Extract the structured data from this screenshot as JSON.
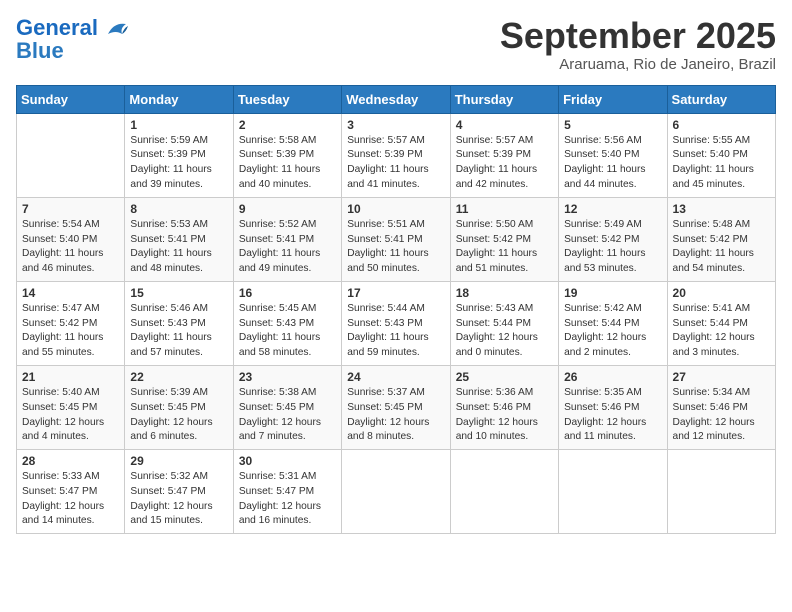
{
  "header": {
    "logo_line1": "General",
    "logo_line2": "Blue",
    "month": "September 2025",
    "location": "Araruama, Rio de Janeiro, Brazil"
  },
  "weekdays": [
    "Sunday",
    "Monday",
    "Tuesday",
    "Wednesday",
    "Thursday",
    "Friday",
    "Saturday"
  ],
  "weeks": [
    [
      {
        "day": "",
        "info": ""
      },
      {
        "day": "1",
        "info": "Sunrise: 5:59 AM\nSunset: 5:39 PM\nDaylight: 11 hours\nand 39 minutes."
      },
      {
        "day": "2",
        "info": "Sunrise: 5:58 AM\nSunset: 5:39 PM\nDaylight: 11 hours\nand 40 minutes."
      },
      {
        "day": "3",
        "info": "Sunrise: 5:57 AM\nSunset: 5:39 PM\nDaylight: 11 hours\nand 41 minutes."
      },
      {
        "day": "4",
        "info": "Sunrise: 5:57 AM\nSunset: 5:39 PM\nDaylight: 11 hours\nand 42 minutes."
      },
      {
        "day": "5",
        "info": "Sunrise: 5:56 AM\nSunset: 5:40 PM\nDaylight: 11 hours\nand 44 minutes."
      },
      {
        "day": "6",
        "info": "Sunrise: 5:55 AM\nSunset: 5:40 PM\nDaylight: 11 hours\nand 45 minutes."
      }
    ],
    [
      {
        "day": "7",
        "info": "Sunrise: 5:54 AM\nSunset: 5:40 PM\nDaylight: 11 hours\nand 46 minutes."
      },
      {
        "day": "8",
        "info": "Sunrise: 5:53 AM\nSunset: 5:41 PM\nDaylight: 11 hours\nand 48 minutes."
      },
      {
        "day": "9",
        "info": "Sunrise: 5:52 AM\nSunset: 5:41 PM\nDaylight: 11 hours\nand 49 minutes."
      },
      {
        "day": "10",
        "info": "Sunrise: 5:51 AM\nSunset: 5:41 PM\nDaylight: 11 hours\nand 50 minutes."
      },
      {
        "day": "11",
        "info": "Sunrise: 5:50 AM\nSunset: 5:42 PM\nDaylight: 11 hours\nand 51 minutes."
      },
      {
        "day": "12",
        "info": "Sunrise: 5:49 AM\nSunset: 5:42 PM\nDaylight: 11 hours\nand 53 minutes."
      },
      {
        "day": "13",
        "info": "Sunrise: 5:48 AM\nSunset: 5:42 PM\nDaylight: 11 hours\nand 54 minutes."
      }
    ],
    [
      {
        "day": "14",
        "info": "Sunrise: 5:47 AM\nSunset: 5:42 PM\nDaylight: 11 hours\nand 55 minutes."
      },
      {
        "day": "15",
        "info": "Sunrise: 5:46 AM\nSunset: 5:43 PM\nDaylight: 11 hours\nand 57 minutes."
      },
      {
        "day": "16",
        "info": "Sunrise: 5:45 AM\nSunset: 5:43 PM\nDaylight: 11 hours\nand 58 minutes."
      },
      {
        "day": "17",
        "info": "Sunrise: 5:44 AM\nSunset: 5:43 PM\nDaylight: 11 hours\nand 59 minutes."
      },
      {
        "day": "18",
        "info": "Sunrise: 5:43 AM\nSunset: 5:44 PM\nDaylight: 12 hours\nand 0 minutes."
      },
      {
        "day": "19",
        "info": "Sunrise: 5:42 AM\nSunset: 5:44 PM\nDaylight: 12 hours\nand 2 minutes."
      },
      {
        "day": "20",
        "info": "Sunrise: 5:41 AM\nSunset: 5:44 PM\nDaylight: 12 hours\nand 3 minutes."
      }
    ],
    [
      {
        "day": "21",
        "info": "Sunrise: 5:40 AM\nSunset: 5:45 PM\nDaylight: 12 hours\nand 4 minutes."
      },
      {
        "day": "22",
        "info": "Sunrise: 5:39 AM\nSunset: 5:45 PM\nDaylight: 12 hours\nand 6 minutes."
      },
      {
        "day": "23",
        "info": "Sunrise: 5:38 AM\nSunset: 5:45 PM\nDaylight: 12 hours\nand 7 minutes."
      },
      {
        "day": "24",
        "info": "Sunrise: 5:37 AM\nSunset: 5:45 PM\nDaylight: 12 hours\nand 8 minutes."
      },
      {
        "day": "25",
        "info": "Sunrise: 5:36 AM\nSunset: 5:46 PM\nDaylight: 12 hours\nand 10 minutes."
      },
      {
        "day": "26",
        "info": "Sunrise: 5:35 AM\nSunset: 5:46 PM\nDaylight: 12 hours\nand 11 minutes."
      },
      {
        "day": "27",
        "info": "Sunrise: 5:34 AM\nSunset: 5:46 PM\nDaylight: 12 hours\nand 12 minutes."
      }
    ],
    [
      {
        "day": "28",
        "info": "Sunrise: 5:33 AM\nSunset: 5:47 PM\nDaylight: 12 hours\nand 14 minutes."
      },
      {
        "day": "29",
        "info": "Sunrise: 5:32 AM\nSunset: 5:47 PM\nDaylight: 12 hours\nand 15 minutes."
      },
      {
        "day": "30",
        "info": "Sunrise: 5:31 AM\nSunset: 5:47 PM\nDaylight: 12 hours\nand 16 minutes."
      },
      {
        "day": "",
        "info": ""
      },
      {
        "day": "",
        "info": ""
      },
      {
        "day": "",
        "info": ""
      },
      {
        "day": "",
        "info": ""
      }
    ]
  ]
}
